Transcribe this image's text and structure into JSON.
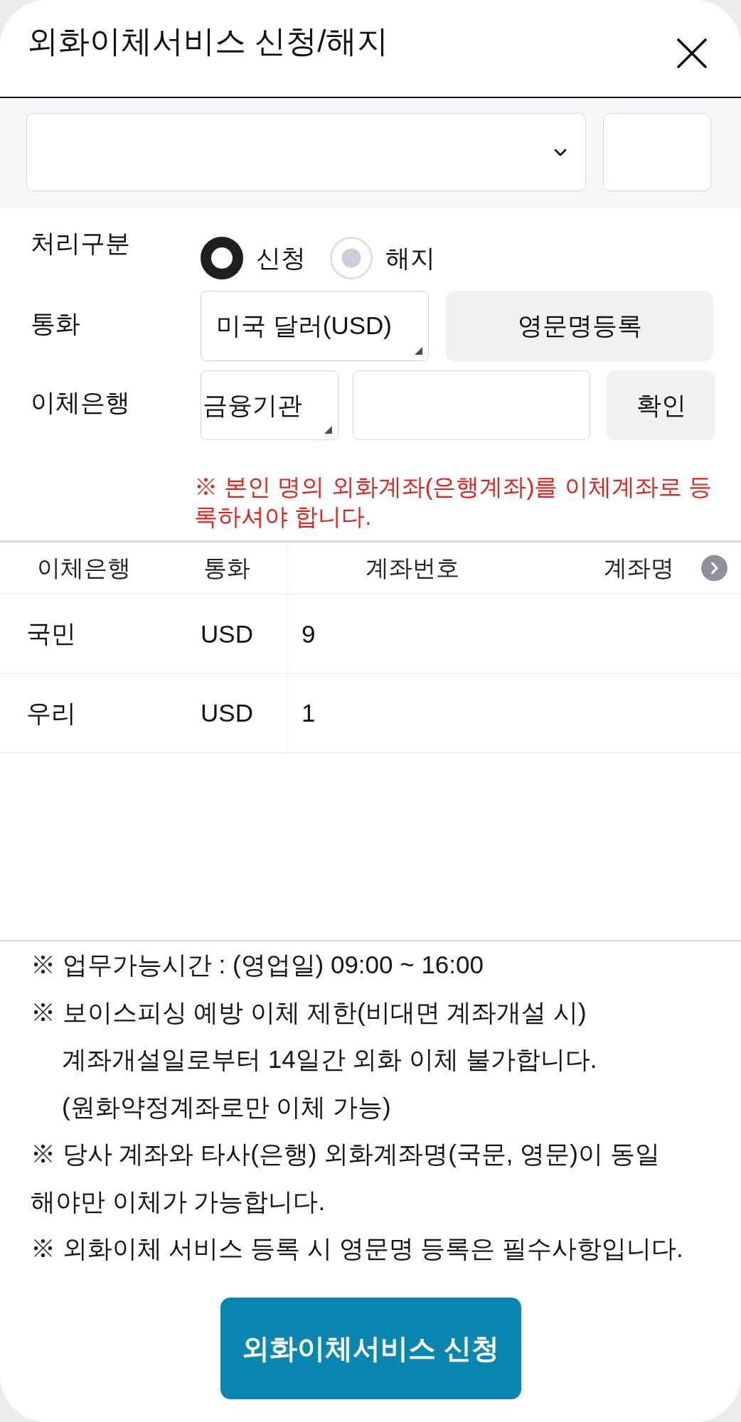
{
  "title": "외화이체서비스 신청/해지",
  "process_type": {
    "label": "처리구분",
    "options": [
      {
        "label": "신청",
        "selected": true
      },
      {
        "label": "해지",
        "selected": false
      }
    ]
  },
  "currency": {
    "label": "통화",
    "value": "미국 달러(USD)",
    "button": "영문명등록"
  },
  "bank": {
    "label": "이체은행",
    "value": "금융기관",
    "button": "확인"
  },
  "notice": "※ 본인 명의 외화계좌(은행계좌)를 이체계좌로 등록하셔야 합니다.",
  "table": {
    "columns": [
      "이체은행",
      "통화",
      "계좌번호",
      "계좌명"
    ],
    "rows": [
      {
        "bank": "국민",
        "currency": "USD",
        "account_number": "9"
      },
      {
        "bank": "우리",
        "currency": "USD",
        "account_number": "1"
      }
    ]
  },
  "notes": [
    {
      "text": "※ 업무가능시간 : (영업일) 09:00 ~ 16:00"
    },
    {
      "text": "※ 보이스피싱 예방 이체 제한(비대면 계좌개설 시)",
      "continuation": [
        "계좌개설일로부터 14일간 외화 이체 불가합니다.",
        "(원화약정계좌로만 이체 가능)"
      ],
      "indented": true
    },
    {
      "text": "※ 당사 계좌와 타사(은행) 외화계좌명(국문, 영문)이 동일",
      "continuation": [
        "해야만 이체가 가능합니다."
      ],
      "indented": false
    },
    {
      "text": "※ 외화이체 서비스 등록 시 영문명 등록은 필수사항입니다."
    }
  ],
  "submit_button": "외화이체서비스 신청"
}
